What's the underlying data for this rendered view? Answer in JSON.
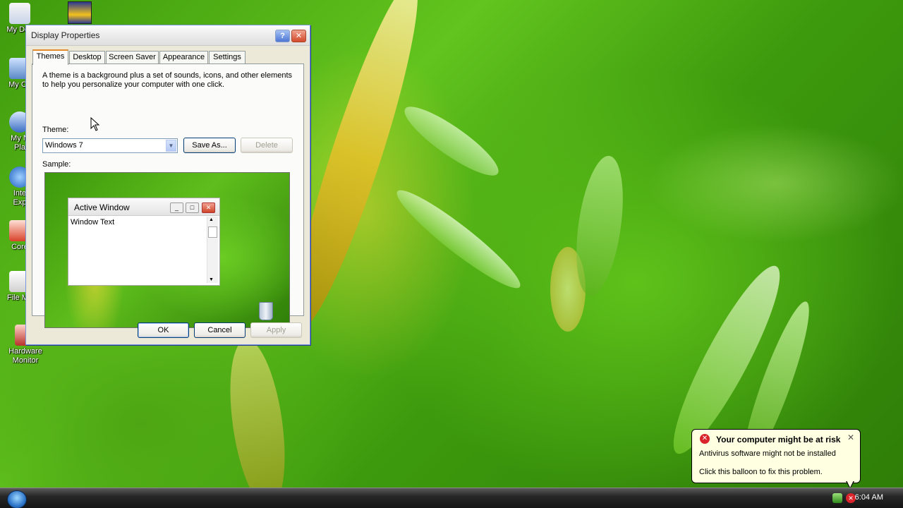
{
  "desktop": {
    "icons": [
      {
        "label": "My Doc"
      },
      {
        "label": "My Co"
      },
      {
        "label": "My N\nPla"
      },
      {
        "label": "Inte\nExp"
      },
      {
        "label": "Core"
      },
      {
        "label": "File Me"
      },
      {
        "label": "Hardware\nMonitor"
      }
    ]
  },
  "dialog": {
    "title": "Display Properties",
    "help_btn": "?",
    "close_btn": "✕",
    "tabs": [
      "Themes",
      "Desktop",
      "Screen Saver",
      "Appearance",
      "Settings"
    ],
    "active_tab": "Themes",
    "description": "A theme is a background plus a set of sounds, icons, and other elements to help you personalize your computer with one click.",
    "theme_label": "Theme:",
    "theme_value": "Windows 7",
    "save_as": "Save As...",
    "delete": "Delete",
    "sample_label": "Sample:",
    "sample": {
      "window_title": "Active Window",
      "window_text": "Window Text"
    },
    "ok": "OK",
    "cancel": "Cancel",
    "apply": "Apply"
  },
  "balloon": {
    "title": "Your computer might be at risk",
    "line1": "Antivirus software might not be installed",
    "line2": "Click this balloon to fix this problem.",
    "close": "✕"
  },
  "taskbar": {
    "clock": "6:04 AM"
  },
  "colors": {
    "accent_tab": "#e68b2c",
    "balloon_bg": "#ffffe1",
    "alert_red": "#d8242a"
  }
}
